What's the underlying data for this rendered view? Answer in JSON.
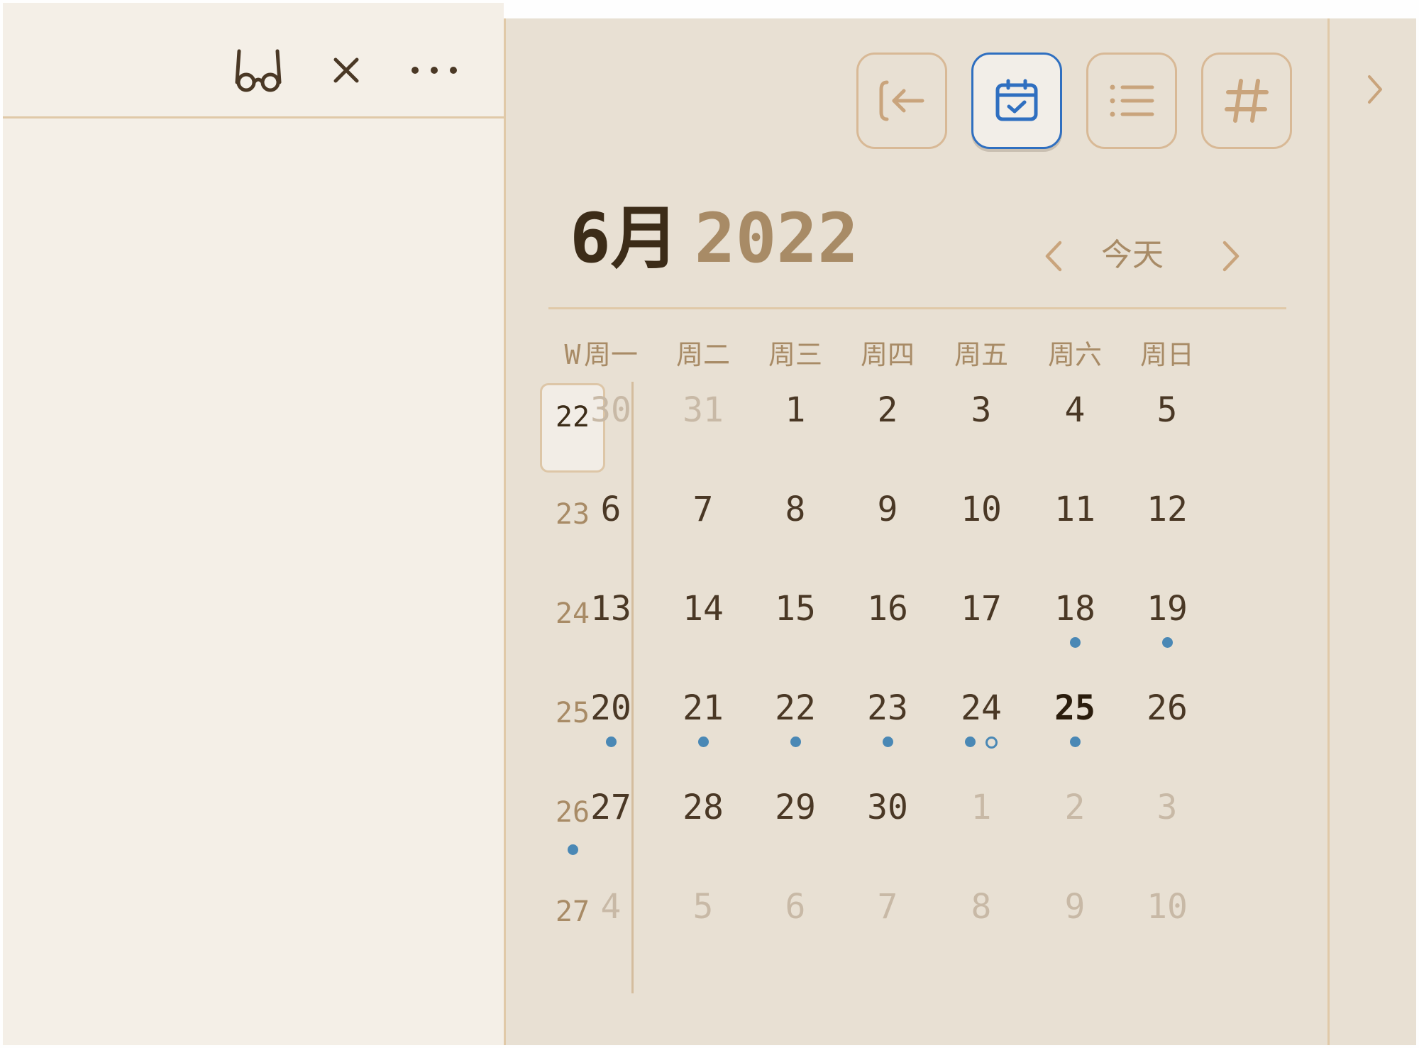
{
  "colors": {
    "accent": "#2f6fc0",
    "dot": "#4a88b5",
    "text_dark": "#3c2c18",
    "text_muted": "#a88b66",
    "panel": "#e8e0d3",
    "editor": "#f4efe7"
  },
  "editor_header": {
    "icons": [
      "reading-glasses-icon",
      "close-icon",
      "more-options-icon"
    ]
  },
  "toolbar": {
    "buttons": [
      {
        "icon": "back-arrow-icon",
        "active": false
      },
      {
        "icon": "calendar-check-icon",
        "active": true
      },
      {
        "icon": "list-icon",
        "active": false
      },
      {
        "icon": "hash-tag-icon",
        "active": false
      }
    ]
  },
  "calendar": {
    "month": "6月",
    "year": "2022",
    "today_label": "今天",
    "week_header": "W",
    "weekdays": [
      "周一",
      "周二",
      "周三",
      "周四",
      "周五",
      "周六",
      "周日"
    ],
    "weeks": [
      {
        "week": "22",
        "current": true,
        "dot": false,
        "days": [
          {
            "d": "30",
            "muted": true
          },
          {
            "d": "31",
            "muted": true
          },
          {
            "d": "1"
          },
          {
            "d": "2"
          },
          {
            "d": "3"
          },
          {
            "d": "4"
          },
          {
            "d": "5"
          }
        ]
      },
      {
        "week": "23",
        "current": false,
        "dot": false,
        "days": [
          {
            "d": "6"
          },
          {
            "d": "7"
          },
          {
            "d": "8"
          },
          {
            "d": "9"
          },
          {
            "d": "10"
          },
          {
            "d": "11"
          },
          {
            "d": "12"
          }
        ]
      },
      {
        "week": "24",
        "current": false,
        "dot": false,
        "days": [
          {
            "d": "13"
          },
          {
            "d": "14"
          },
          {
            "d": "15"
          },
          {
            "d": "16"
          },
          {
            "d": "17"
          },
          {
            "d": "18",
            "dots": [
              "filled"
            ]
          },
          {
            "d": "19",
            "dots": [
              "filled"
            ]
          }
        ]
      },
      {
        "week": "25",
        "current": false,
        "dot": false,
        "days": [
          {
            "d": "20",
            "dots": [
              "filled"
            ]
          },
          {
            "d": "21",
            "dots": [
              "filled"
            ]
          },
          {
            "d": "22",
            "dots": [
              "filled"
            ]
          },
          {
            "d": "23",
            "dots": [
              "filled"
            ]
          },
          {
            "d": "24",
            "dots": [
              "filled",
              "hollow"
            ]
          },
          {
            "d": "25",
            "today": true,
            "dots": [
              "filled"
            ]
          },
          {
            "d": "26"
          }
        ]
      },
      {
        "week": "26",
        "current": false,
        "dot": true,
        "days": [
          {
            "d": "27"
          },
          {
            "d": "28"
          },
          {
            "d": "29"
          },
          {
            "d": "30"
          },
          {
            "d": "1",
            "muted": true
          },
          {
            "d": "2",
            "muted": true
          },
          {
            "d": "3",
            "muted": true
          }
        ]
      },
      {
        "week": "27",
        "current": false,
        "dot": false,
        "days": [
          {
            "d": "4",
            "muted": true
          },
          {
            "d": "5",
            "muted": true
          },
          {
            "d": "6",
            "muted": true
          },
          {
            "d": "7",
            "muted": true
          },
          {
            "d": "8",
            "muted": true
          },
          {
            "d": "9",
            "muted": true
          },
          {
            "d": "10",
            "muted": true
          }
        ]
      }
    ]
  },
  "gutter": {
    "expand_icon": "chevron-right-icon"
  }
}
